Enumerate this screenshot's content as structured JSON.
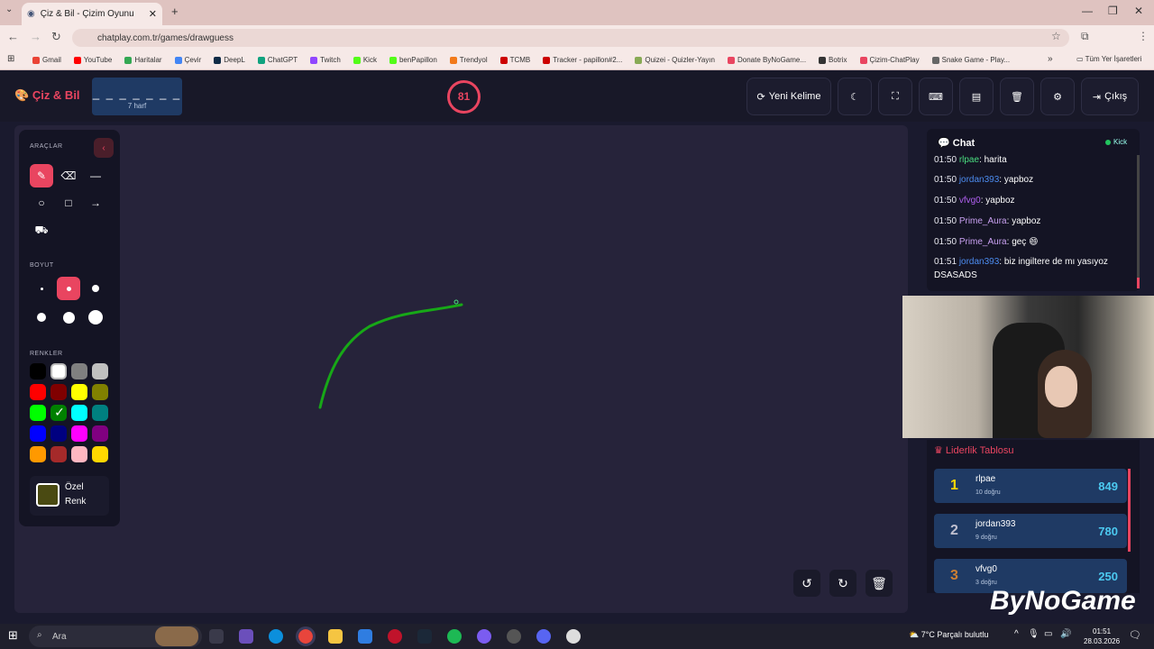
{
  "browser": {
    "tab_title": "Çiz & Bil - Çizim Oyunu",
    "url": "chatplay.com.tr/games/drawguess",
    "bookmarks": [
      "Gmail",
      "YouTube",
      "Haritalar",
      "Çevir",
      "DeepL",
      "ChatGPT",
      "Twitch",
      "Kick",
      "benPapillon",
      "Trendyol",
      "TCMB",
      "Tracker - papillon#2...",
      "Quizei - Quizler-Yayın",
      "Donate ByNoGame...",
      "Botrix",
      "Çizim-ChatPlay",
      "Snake Game - Play..."
    ],
    "all_bookmarks": "Tüm Yer İşaretleri",
    "bookmark_colors": [
      "#ea4335",
      "#ff0000",
      "#34a853",
      "#4285f4",
      "#0f2b46",
      "#10a37f",
      "#9146ff",
      "#53fc18",
      "#53fc18",
      "#f27a1a",
      "#c00",
      "#c00",
      "#8a5",
      "#e94560",
      "#333",
      "#e94560",
      "#666"
    ]
  },
  "header": {
    "logo": "Çiz & Bil",
    "word_mask": "_ _ _ _ _ _ _",
    "word_hint": "7 harf",
    "timer": "81",
    "new_word": "Yeni Kelime",
    "exit": "Çıkış"
  },
  "tools": {
    "section_tools": "ARAÇLAR",
    "section_size": "BOYUT",
    "section_colors": "RENKLER",
    "custom_color_l1": "Özel",
    "custom_color_l2": "Renk",
    "custom_color": "#4a4a12",
    "palette": [
      "#000000",
      "#ffffff",
      "#808080",
      "#c0c0c0",
      "#ff0000",
      "#800000",
      "#ffff00",
      "#808000",
      "#00ff00",
      "#008000",
      "#00ffff",
      "#008080",
      "#0000ff",
      "#000080",
      "#ff00ff",
      "#800080",
      "#ff9900",
      "#a52a2a",
      "#ffb6c1",
      "#ffd700"
    ]
  },
  "chat": {
    "title": "Chat",
    "source": "Kick",
    "messages": [
      {
        "time": "01:50",
        "user": "rlpae",
        "text": "harita",
        "color": "#4ade80"
      },
      {
        "time": "01:50",
        "user": "jordan393",
        "text": "yapboz",
        "color": "#4c8cf0"
      },
      {
        "time": "01:50",
        "user": "vfvg0",
        "text": "yapboz",
        "color": "#b060f0"
      },
      {
        "time": "01:50",
        "user": "Prime_Aura",
        "text": "yapboz",
        "color": "#c8a0f0"
      },
      {
        "time": "01:50",
        "user": "Prime_Aura",
        "text": "geç 😄",
        "color": "#c8a0f0"
      },
      {
        "time": "01:51",
        "user": "jordan393",
        "text": "biz ingiltere de mı yasıyoz DSASADS",
        "color": "#4c8cf0"
      }
    ]
  },
  "leaderboard": {
    "title": "Liderlik Tablosu",
    "rows": [
      {
        "rank": "1",
        "name": "rlpae",
        "sub": "10 doğru",
        "score": "849",
        "color": "#ffd700"
      },
      {
        "rank": "2",
        "name": "jordan393",
        "sub": "9 doğru",
        "score": "780",
        "color": "#c0c0d0"
      },
      {
        "rank": "3",
        "name": "vfvg0",
        "sub": "3 doğru",
        "score": "250",
        "color": "#cd7f32"
      }
    ]
  },
  "watermark": "ByNoGame",
  "taskbar": {
    "search": "Ara",
    "weather": "7°C  Parçalı bulutlu",
    "time": "01:51",
    "date": "28.03.2026"
  }
}
